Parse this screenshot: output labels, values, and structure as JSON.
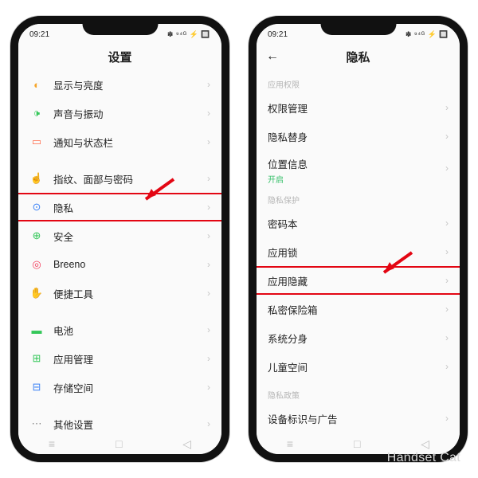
{
  "status": {
    "time": "09:21",
    "icons": "✽ ⁹⁴ᴳ ⚡ 🔲"
  },
  "watermark": "Handset Cat",
  "phone1": {
    "title": "设置",
    "rows": [
      {
        "icon": "◐",
        "color": "#f6a52a",
        "label": "显示与亮度"
      },
      {
        "icon": "🕩",
        "color": "#34c759",
        "label": "声音与振动"
      },
      {
        "icon": "▭",
        "color": "#ff6b4a",
        "label": "通知与状态栏"
      },
      {
        "gap": true
      },
      {
        "icon": "☝",
        "color": "#3b82f6",
        "label": "指纹、面部与密码"
      },
      {
        "icon": "⊙",
        "color": "#3b82f6",
        "label": "隐私",
        "highlight": true
      },
      {
        "icon": "⊕",
        "color": "#34c759",
        "label": "安全"
      },
      {
        "icon": "◎",
        "color": "#f43f5e",
        "label": "Breeno"
      },
      {
        "icon": "✋",
        "color": "#f6a52a",
        "label": "便捷工具"
      },
      {
        "gap": true
      },
      {
        "icon": "▬",
        "color": "#34c759",
        "label": "电池"
      },
      {
        "icon": "⊞",
        "color": "#34c759",
        "label": "应用管理"
      },
      {
        "icon": "⊟",
        "color": "#3b82f6",
        "label": "存储空间"
      },
      {
        "gap": true
      },
      {
        "icon": "⋯",
        "color": "#888",
        "label": "其他设置"
      }
    ]
  },
  "phone2": {
    "title": "隐私",
    "sections": [
      {
        "title": "应用权限",
        "rows": [
          {
            "label": "权限管理"
          },
          {
            "label": "隐私替身"
          },
          {
            "label": "位置信息",
            "sub": "开启",
            "tall": true
          }
        ]
      },
      {
        "title": "隐私保护",
        "rows": [
          {
            "label": "密码本"
          },
          {
            "label": "应用锁"
          },
          {
            "label": "应用隐藏",
            "highlight": true
          },
          {
            "label": "私密保险箱"
          },
          {
            "label": "系统分身"
          },
          {
            "label": "儿童空间"
          }
        ]
      },
      {
        "title": "隐私政策",
        "rows": [
          {
            "label": "设备标识与广告"
          }
        ]
      }
    ]
  },
  "nav": {
    "recent": "≡",
    "home": "□",
    "back": "◁"
  }
}
